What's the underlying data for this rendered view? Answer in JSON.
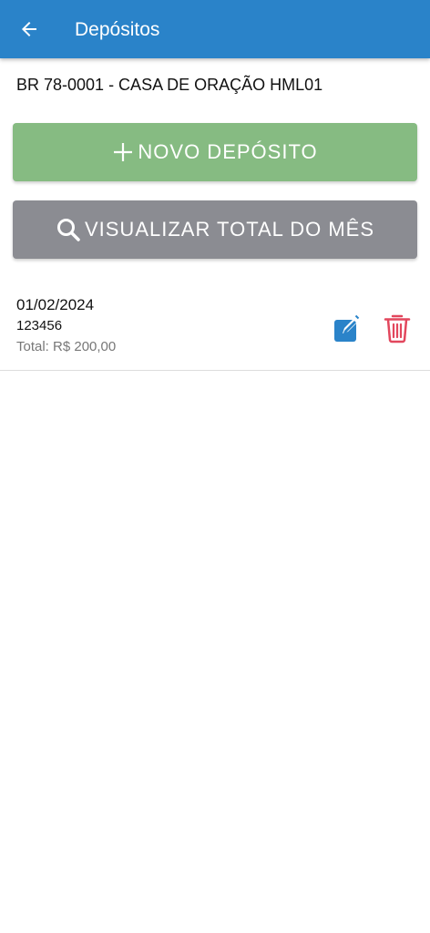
{
  "header": {
    "back_icon": "arrow-left-icon",
    "title": "Depósitos",
    "background_color": "#2a83c9"
  },
  "church": {
    "name": "BR 78-0001 - CASA DE ORAÇÃO HML01"
  },
  "actions": {
    "new_deposit": {
      "label": "NOVO DEPÓSITO",
      "icon": "plus-icon",
      "color": "#86bb82"
    },
    "view_month_total": {
      "label": "VISUALIZAR TOTAL DO MÊS",
      "icon": "search-icon",
      "color": "#8b8c92"
    }
  },
  "deposits": [
    {
      "date": "01/02/2024",
      "number": "123456",
      "total": "Total: R$ 200,00",
      "edit_icon": "edit-icon",
      "delete_icon": "trash-icon",
      "edit_color": "#2a83c9",
      "delete_color": "#e2475d"
    }
  ]
}
